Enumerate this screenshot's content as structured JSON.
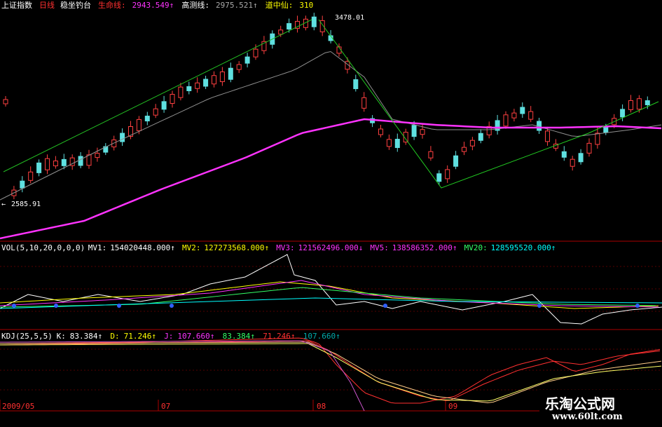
{
  "main_panel": {
    "items": [
      {
        "text": "上证指数",
        "color": "#ffffff"
      },
      {
        "text": "日线",
        "color": "#ff3030"
      },
      {
        "text": "稳坐钓台",
        "color": "#ffffff"
      },
      {
        "text": "生命线:",
        "color": "#ff3030"
      },
      {
        "text": "2943.549↑",
        "color": "#ff33ff"
      },
      {
        "text": "高测线:",
        "color": "#ffffff"
      },
      {
        "text": "2975.521↑",
        "color": "#aaaaaa"
      },
      {
        "text": "道中仙:",
        "color": "#ffff00"
      },
      {
        "text": "310",
        "color": "#ffff00"
      }
    ],
    "high_label": "3478.01",
    "low_label": "2585.91"
  },
  "vol_panel": {
    "items": [
      {
        "text": "VOL(5,10,20,0,0,0)",
        "color": "#ffffff"
      },
      {
        "text": "MV1:",
        "color": "#ffffff"
      },
      {
        "text": "154020448.000↑",
        "color": "#ffffff"
      },
      {
        "text": "MV2:",
        "color": "#ffff00"
      },
      {
        "text": "127273568.000↑",
        "color": "#ffff00"
      },
      {
        "text": "MV3:",
        "color": "#ff33ff"
      },
      {
        "text": "121562496.000↓",
        "color": "#ff33ff"
      },
      {
        "text": "MV5:",
        "color": "#ff33ff"
      },
      {
        "text": "138586352.000↑",
        "color": "#ff33ff"
      },
      {
        "text": "MV20:",
        "color": "#33ff66"
      },
      {
        "text": "128595520.000↑",
        "color": "#00ffff"
      }
    ]
  },
  "kdj_panel": {
    "items": [
      {
        "text": "KDJ(25,5,5)",
        "color": "#ffffff"
      },
      {
        "text": "K:",
        "color": "#ffffff"
      },
      {
        "text": "83.384↑",
        "color": "#ffffff"
      },
      {
        "text": "D:",
        "color": "#ffff00"
      },
      {
        "text": "71.246↑",
        "color": "#ffff00"
      },
      {
        "text": "J:",
        "color": "#ff33ff"
      },
      {
        "text": "107.660↑",
        "color": "#ff33ff"
      },
      {
        "text": "83.384↑",
        "color": "#33ff66"
      },
      {
        "text": "71.246↑",
        "color": "#ff3030"
      },
      {
        "text": "107.660↑",
        "color": "#00aaaa"
      }
    ]
  },
  "time_axis": [
    "2009/05",
    "07",
    "08",
    "09"
  ],
  "watermark": {
    "line1": "乐淘公式网",
    "line2": "www.60lt.com"
  }
}
